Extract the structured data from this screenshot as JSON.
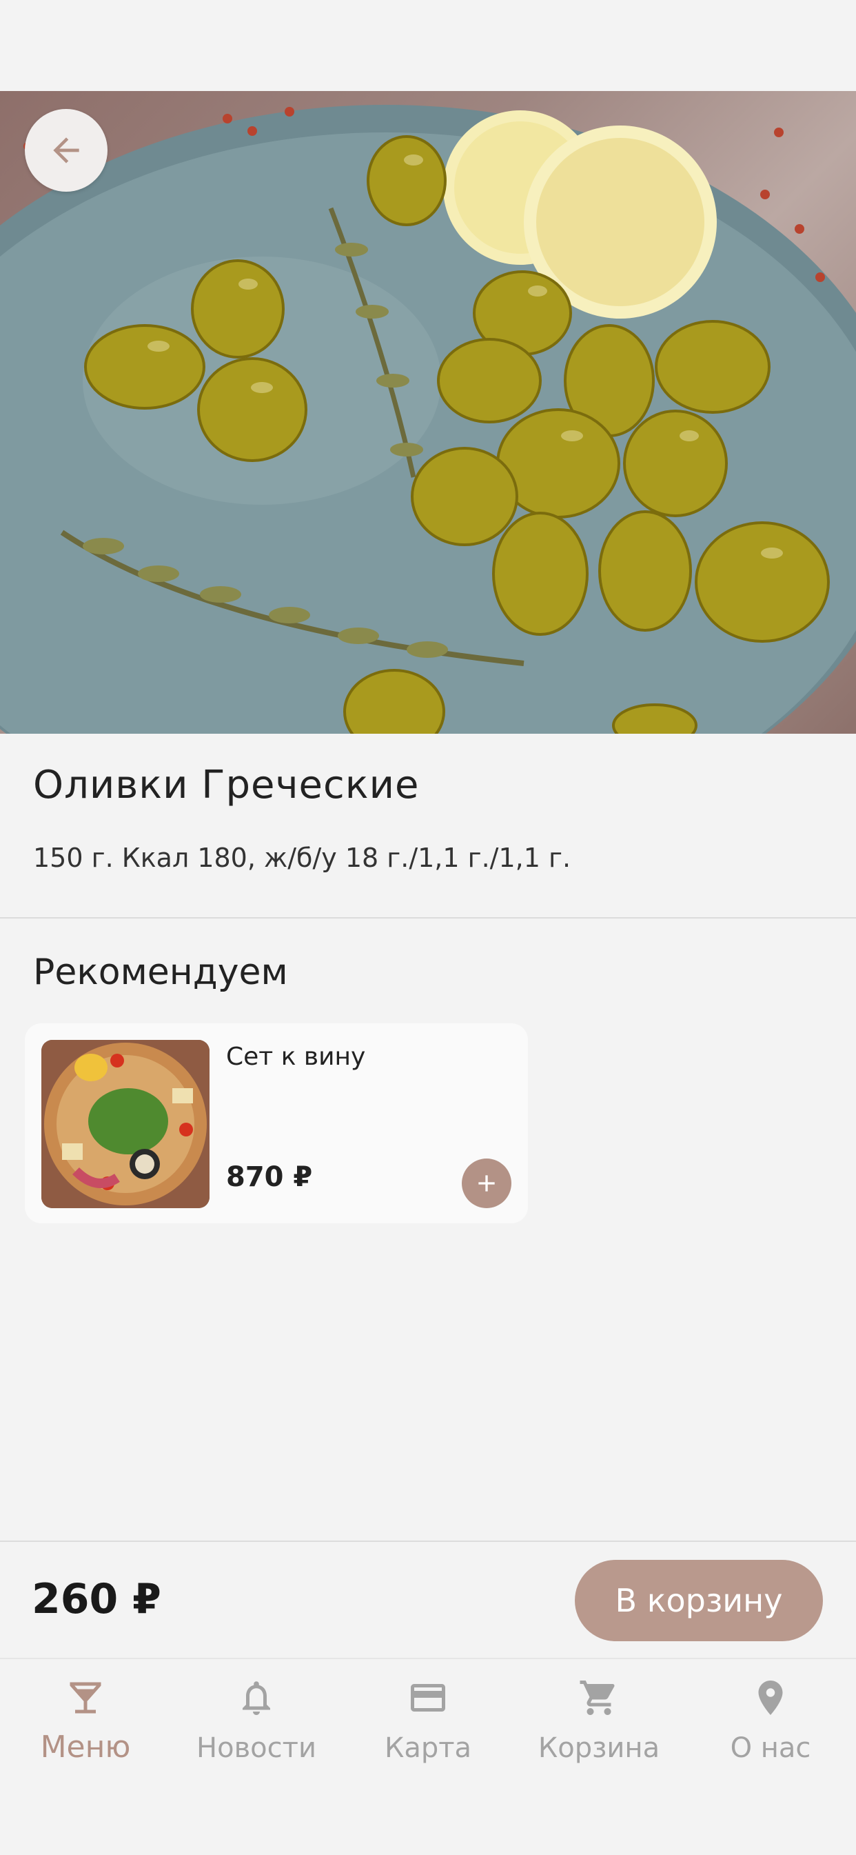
{
  "product": {
    "title": "Оливки Греческие",
    "details": "150 г. Ккал 180, ж/б/у 18 г./1,1 г./1,1 г.",
    "price": "260 ₽",
    "add_to_cart_label": "В корзину"
  },
  "recommendations": {
    "heading": "Рекомендуем",
    "items": [
      {
        "name": "Сет к вину",
        "price": "870 ₽"
      }
    ]
  },
  "tabs": [
    {
      "label": "Меню",
      "icon": "cocktail-glass-icon",
      "active": true
    },
    {
      "label": "Новости",
      "icon": "bell-icon",
      "active": false
    },
    {
      "label": "Карта",
      "icon": "credit-card-icon",
      "active": false
    },
    {
      "label": "Корзина",
      "icon": "cart-icon",
      "active": false
    },
    {
      "label": "О нас",
      "icon": "location-pin-icon",
      "active": false
    }
  ],
  "colors": {
    "accent": "#b39286",
    "button": "#b9998d",
    "inactive": "#a3a3a3",
    "background": "#f3f3f3"
  }
}
